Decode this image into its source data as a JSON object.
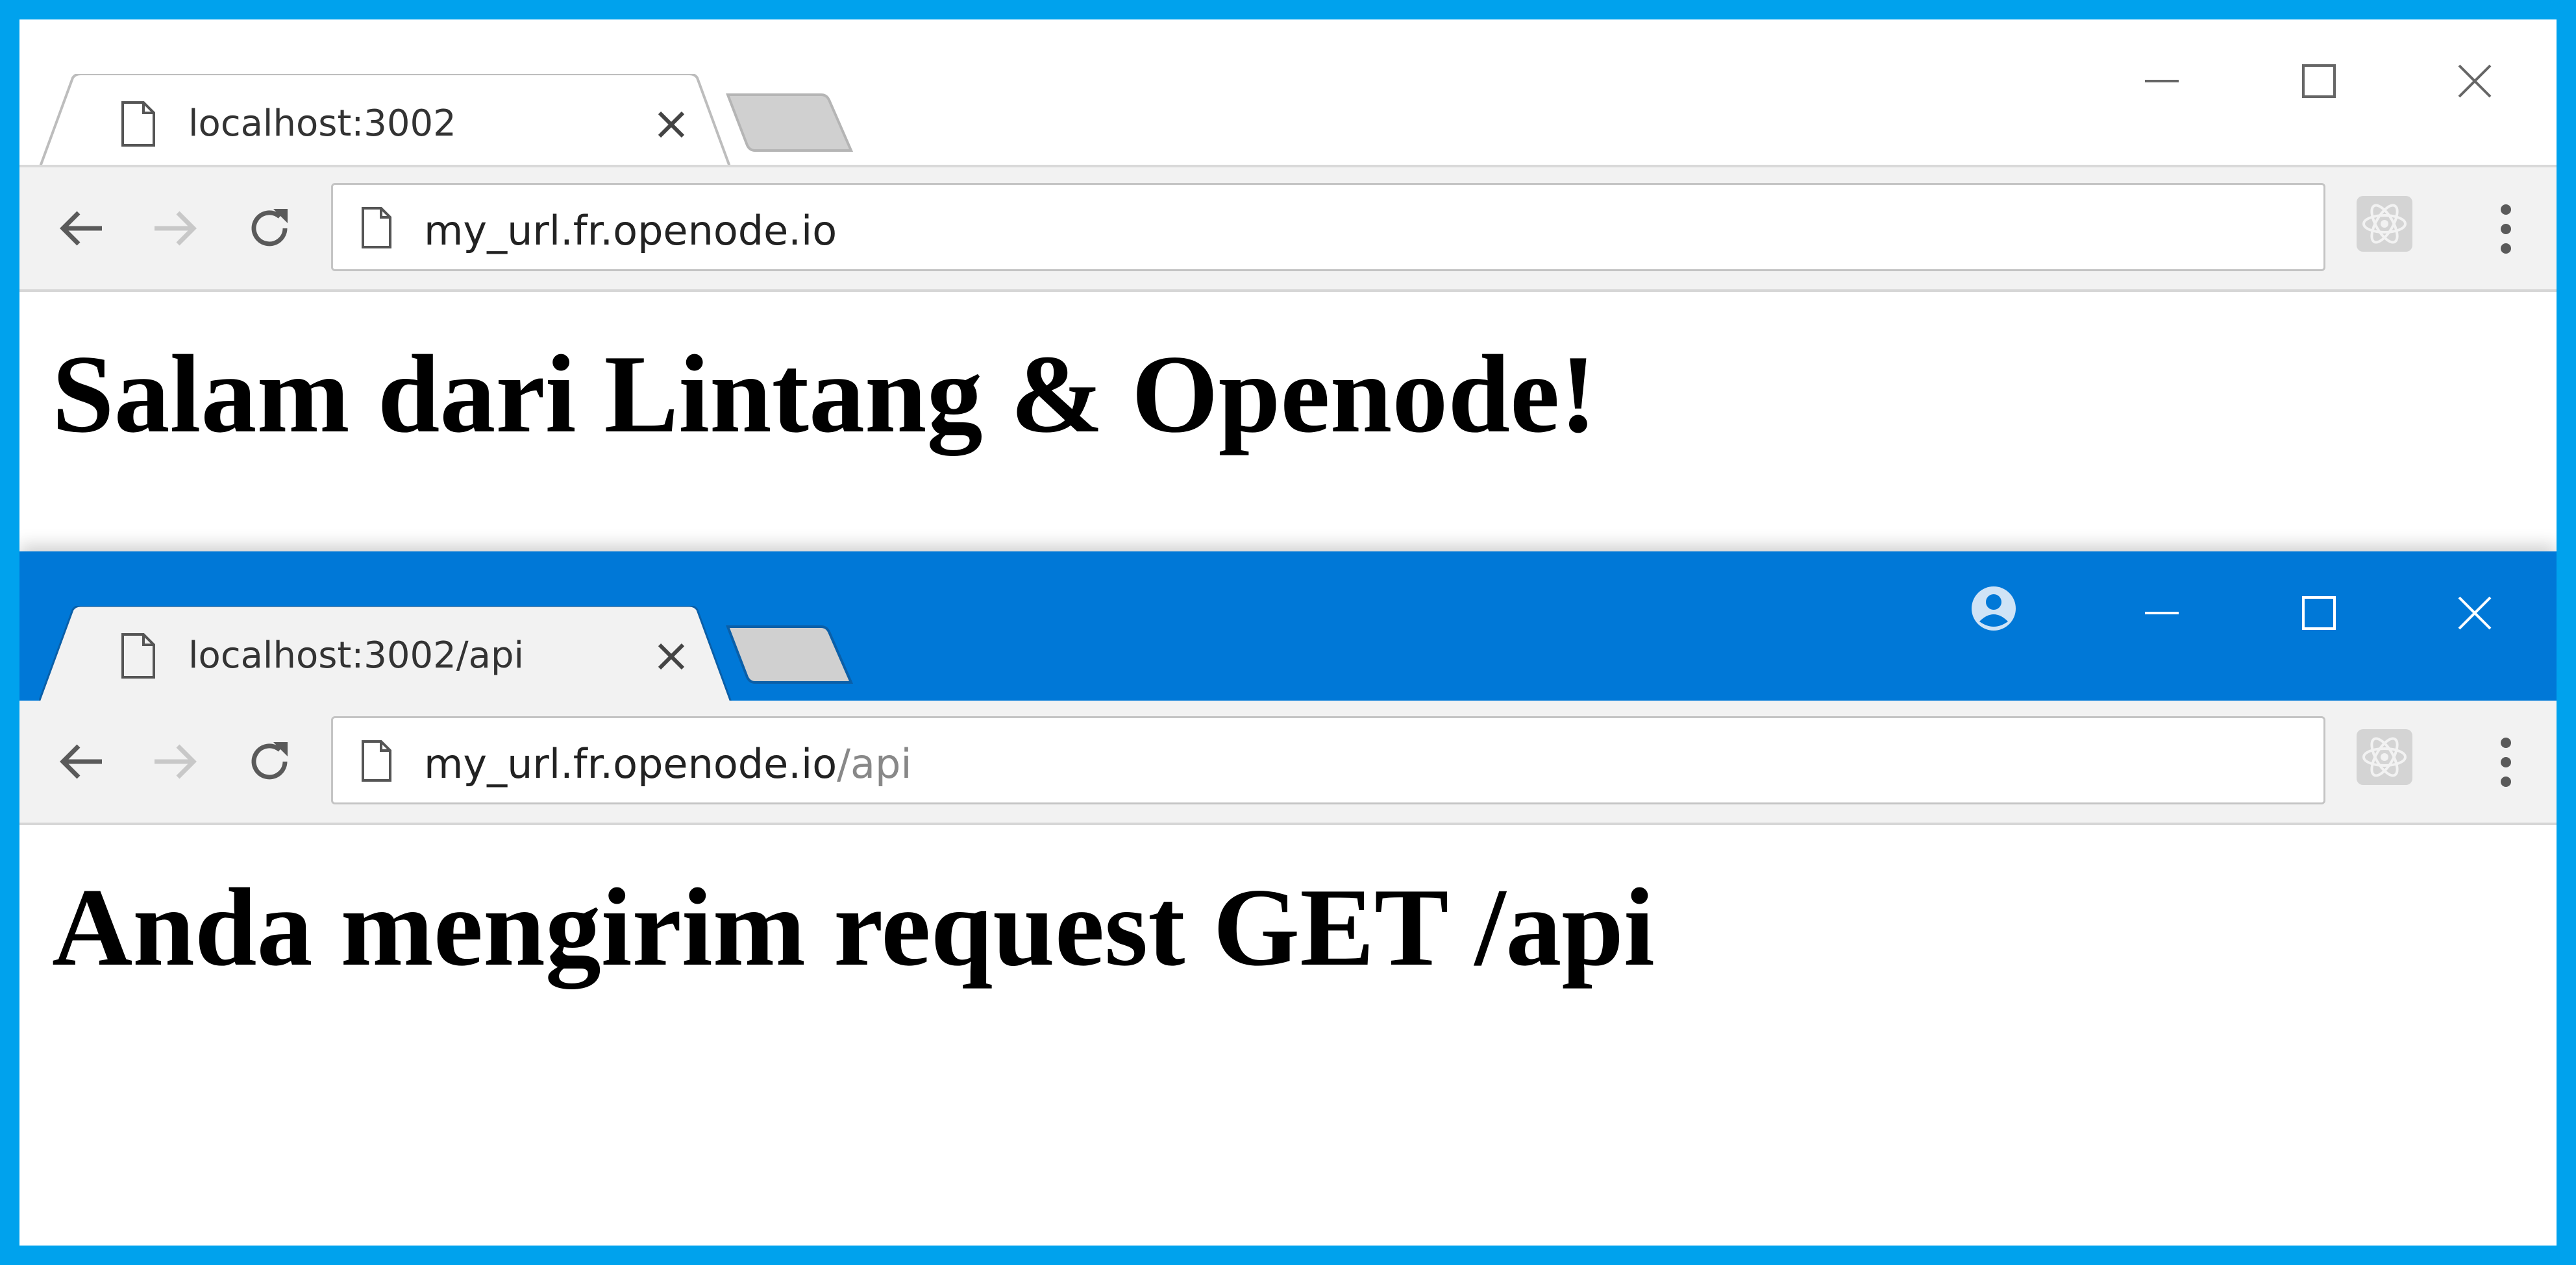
{
  "colors": {
    "border": "#00a2ed",
    "active_titlebar": "#0078d7",
    "inactive_titlebar": "#ffffff",
    "toolbar": "#f2f2f2"
  },
  "windows": [
    {
      "tab": {
        "title": "localhost:3002",
        "icon": "page-icon",
        "close_label": "×"
      },
      "address": {
        "host": "my_url.fr.openode.io",
        "path": ""
      },
      "page": {
        "heading": "Salam dari Lintang & Openode!"
      },
      "active": false
    },
    {
      "tab": {
        "title": "localhost:3002/api",
        "icon": "page-icon",
        "close_label": "×"
      },
      "address": {
        "host": "my_url.fr.openode.io",
        "path": "/api"
      },
      "page": {
        "heading": "Anda mengirim request GET /api"
      },
      "active": true
    }
  ],
  "icons": {
    "nav": [
      "back-arrow-icon",
      "forward-arrow-icon",
      "reload-icon"
    ],
    "window_controls": [
      "minimize-icon",
      "maximize-icon",
      "close-icon"
    ],
    "extension": "react-devtools-icon",
    "menu": "kebab-menu-icon",
    "profile": "profile-icon"
  }
}
